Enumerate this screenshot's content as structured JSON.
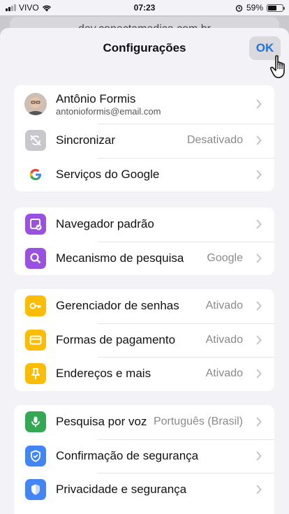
{
  "status": {
    "carrier": "VIVO",
    "time": "07:23",
    "battery": "59%"
  },
  "background": {
    "url": "dev.conectamedica.com.br"
  },
  "header": {
    "title": "Configurações",
    "ok_label": "OK"
  },
  "profile": {
    "name": "Antônio Formis",
    "email": "antonioformis@email.com"
  },
  "group1": [
    {
      "label": "Sincronizar",
      "value": "Desativado",
      "icon": "sync-off-icon"
    },
    {
      "label": "Serviços do Google",
      "value": "",
      "icon": "google-icon"
    }
  ],
  "group2": [
    {
      "label": "Navegador padrão",
      "value": "",
      "icon": "default-browser-icon"
    },
    {
      "label": "Mecanismo de pesquisa",
      "value": "Google",
      "icon": "search-icon"
    }
  ],
  "group3": [
    {
      "label": "Gerenciador de senhas",
      "value": "Ativado",
      "icon": "key-icon"
    },
    {
      "label": "Formas de pagamento",
      "value": "Ativado",
      "icon": "credit-card-icon"
    },
    {
      "label": "Endereços e mais",
      "value": "Ativado",
      "icon": "pin-icon"
    }
  ],
  "group4": [
    {
      "label": "Pesquisa por voz",
      "value": "Português (Brasil)",
      "icon": "microphone-icon"
    },
    {
      "label": "Confirmação de segurança",
      "value": "",
      "icon": "shield-check-icon"
    },
    {
      "label": "Privacidade e segurança",
      "value": "",
      "icon": "privacy-shield-icon"
    }
  ],
  "colors": {
    "accent": "#1a73e8",
    "purple": "#9b51e0",
    "yellow": "#fbbc04",
    "green": "#34a853",
    "blue": "#4285f4"
  }
}
